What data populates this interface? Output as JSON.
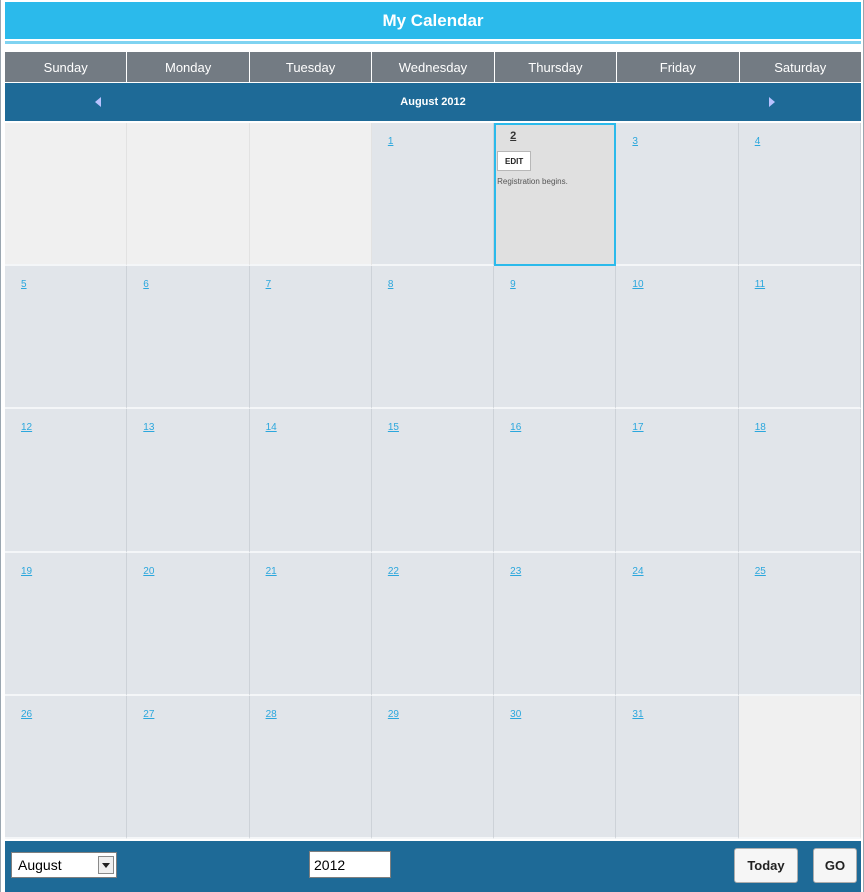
{
  "header": {
    "title": "My Calendar"
  },
  "weekdays": [
    "Sunday",
    "Monday",
    "Tuesday",
    "Wednesday",
    "Thursday",
    "Friday",
    "Saturday"
  ],
  "nav": {
    "month_label": "August 2012"
  },
  "weeks": [
    [
      null,
      null,
      null,
      "1",
      "2",
      "3",
      "4"
    ],
    [
      "5",
      "6",
      "7",
      "8",
      "9",
      "10",
      "11"
    ],
    [
      "12",
      "13",
      "14",
      "15",
      "16",
      "17",
      "18"
    ],
    [
      "19",
      "20",
      "21",
      "22",
      "23",
      "24",
      "25"
    ],
    [
      "26",
      "27",
      "28",
      "29",
      "30",
      "31",
      null
    ]
  ],
  "selected_day": "2",
  "event": {
    "day": "2",
    "edit_label": "EDIT",
    "text": "Registration begins."
  },
  "footer": {
    "month_value": "August",
    "year_value": "2012",
    "today_label": "Today",
    "go_label": "GO"
  },
  "colors": {
    "title_bar": "#2bbaeb",
    "nav_bar": "#1e6a97",
    "weekday_header": "#737b83",
    "day_cell": "#e1e5ea",
    "empty_cell": "#f0f0f0",
    "link": "#2ba7dd"
  }
}
